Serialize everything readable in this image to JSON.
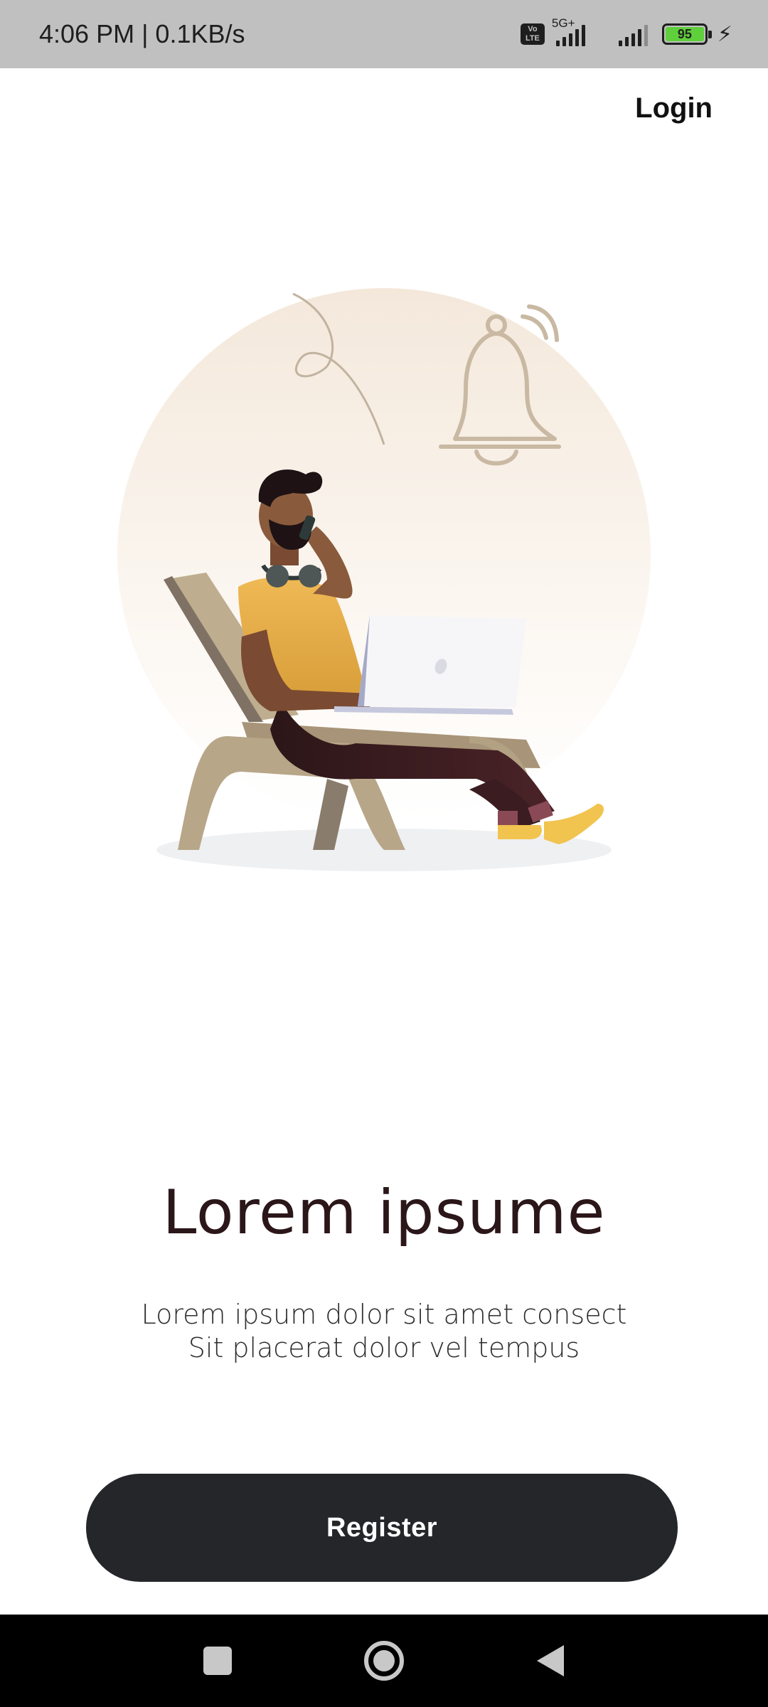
{
  "status_bar": {
    "time_speed": "4:06 PM | 0.1KB/s",
    "volte_label": "Vo LTE",
    "network_type": "5G+",
    "battery_level": "95",
    "battery_color": "#5fcf3c"
  },
  "header": {
    "login_label": "Login"
  },
  "illustration": {
    "icon": "person-with-laptop-illustration"
  },
  "main": {
    "headline": "Lorem ipsume",
    "subtitle_line1": "Lorem ipsum dolor sit amet consect",
    "subtitle_line2": "Sit placerat dolor vel tempus"
  },
  "actions": {
    "register_label": "Register",
    "button_color": "#24262a"
  },
  "nav_bar": {
    "recents_icon": "square-icon",
    "home_icon": "circle-icon",
    "back_icon": "triangle-back-icon"
  }
}
